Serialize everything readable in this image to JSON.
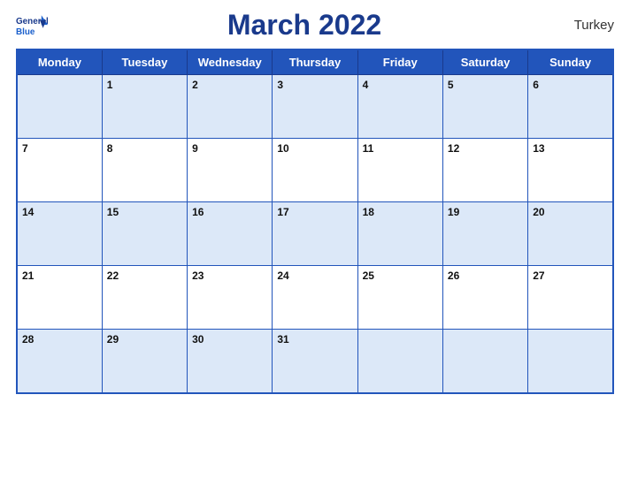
{
  "header": {
    "logo_general": "General",
    "logo_blue": "Blue",
    "title": "March 2022",
    "country": "Turkey"
  },
  "weekdays": [
    "Monday",
    "Tuesday",
    "Wednesday",
    "Thursday",
    "Friday",
    "Saturday",
    "Sunday"
  ],
  "weeks": [
    [
      {
        "day": "",
        "empty": true
      },
      {
        "day": "1"
      },
      {
        "day": "2"
      },
      {
        "day": "3"
      },
      {
        "day": "4"
      },
      {
        "day": "5"
      },
      {
        "day": "6"
      }
    ],
    [
      {
        "day": "7"
      },
      {
        "day": "8"
      },
      {
        "day": "9"
      },
      {
        "day": "10"
      },
      {
        "day": "11"
      },
      {
        "day": "12"
      },
      {
        "day": "13"
      }
    ],
    [
      {
        "day": "14"
      },
      {
        "day": "15"
      },
      {
        "day": "16"
      },
      {
        "day": "17"
      },
      {
        "day": "18"
      },
      {
        "day": "19"
      },
      {
        "day": "20"
      }
    ],
    [
      {
        "day": "21"
      },
      {
        "day": "22"
      },
      {
        "day": "23"
      },
      {
        "day": "24"
      },
      {
        "day": "25"
      },
      {
        "day": "26"
      },
      {
        "day": "27"
      }
    ],
    [
      {
        "day": "28"
      },
      {
        "day": "29"
      },
      {
        "day": "30"
      },
      {
        "day": "31"
      },
      {
        "day": ""
      },
      {
        "day": ""
      },
      {
        "day": ""
      }
    ]
  ]
}
